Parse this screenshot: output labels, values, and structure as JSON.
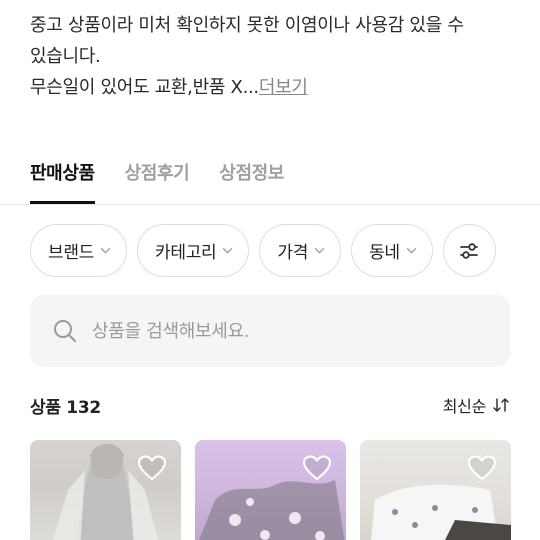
{
  "description": {
    "line1": "중고 상품이라 미처 확인하지 못한 이염이나 사용감 있을 수",
    "line2": "있습니다.",
    "line3": "무슨일이 있어도 교환,반품 X...",
    "more_link": "더보기"
  },
  "tabs": [
    {
      "label": "판매상품",
      "active": true
    },
    {
      "label": "상점후기",
      "active": false
    },
    {
      "label": "상점정보",
      "active": false
    }
  ],
  "filters": [
    {
      "label": "브랜드"
    },
    {
      "label": "카테고리"
    },
    {
      "label": "가격"
    },
    {
      "label": "동네"
    }
  ],
  "filter_settings_icon": "sliders-icon",
  "search": {
    "icon": "search-icon",
    "placeholder": "상품을 검색해보세요."
  },
  "products_header": {
    "count_label": "상품 132",
    "sort_label": "최신순",
    "sort_icon": "sort-arrows-icon"
  },
  "products": [
    {
      "heart_icon": "heart-icon",
      "image": "light gray sleeveless dress photo"
    },
    {
      "heart_icon": "heart-icon",
      "image": "lavender floral garment photo"
    },
    {
      "heart_icon": "heart-icon",
      "image": "white floral garment photo"
    }
  ],
  "colors": {
    "text_primary": "#222222",
    "text_muted": "#a0a0a0",
    "chip_border": "#dedede",
    "search_bg": "#f5f5f5"
  }
}
